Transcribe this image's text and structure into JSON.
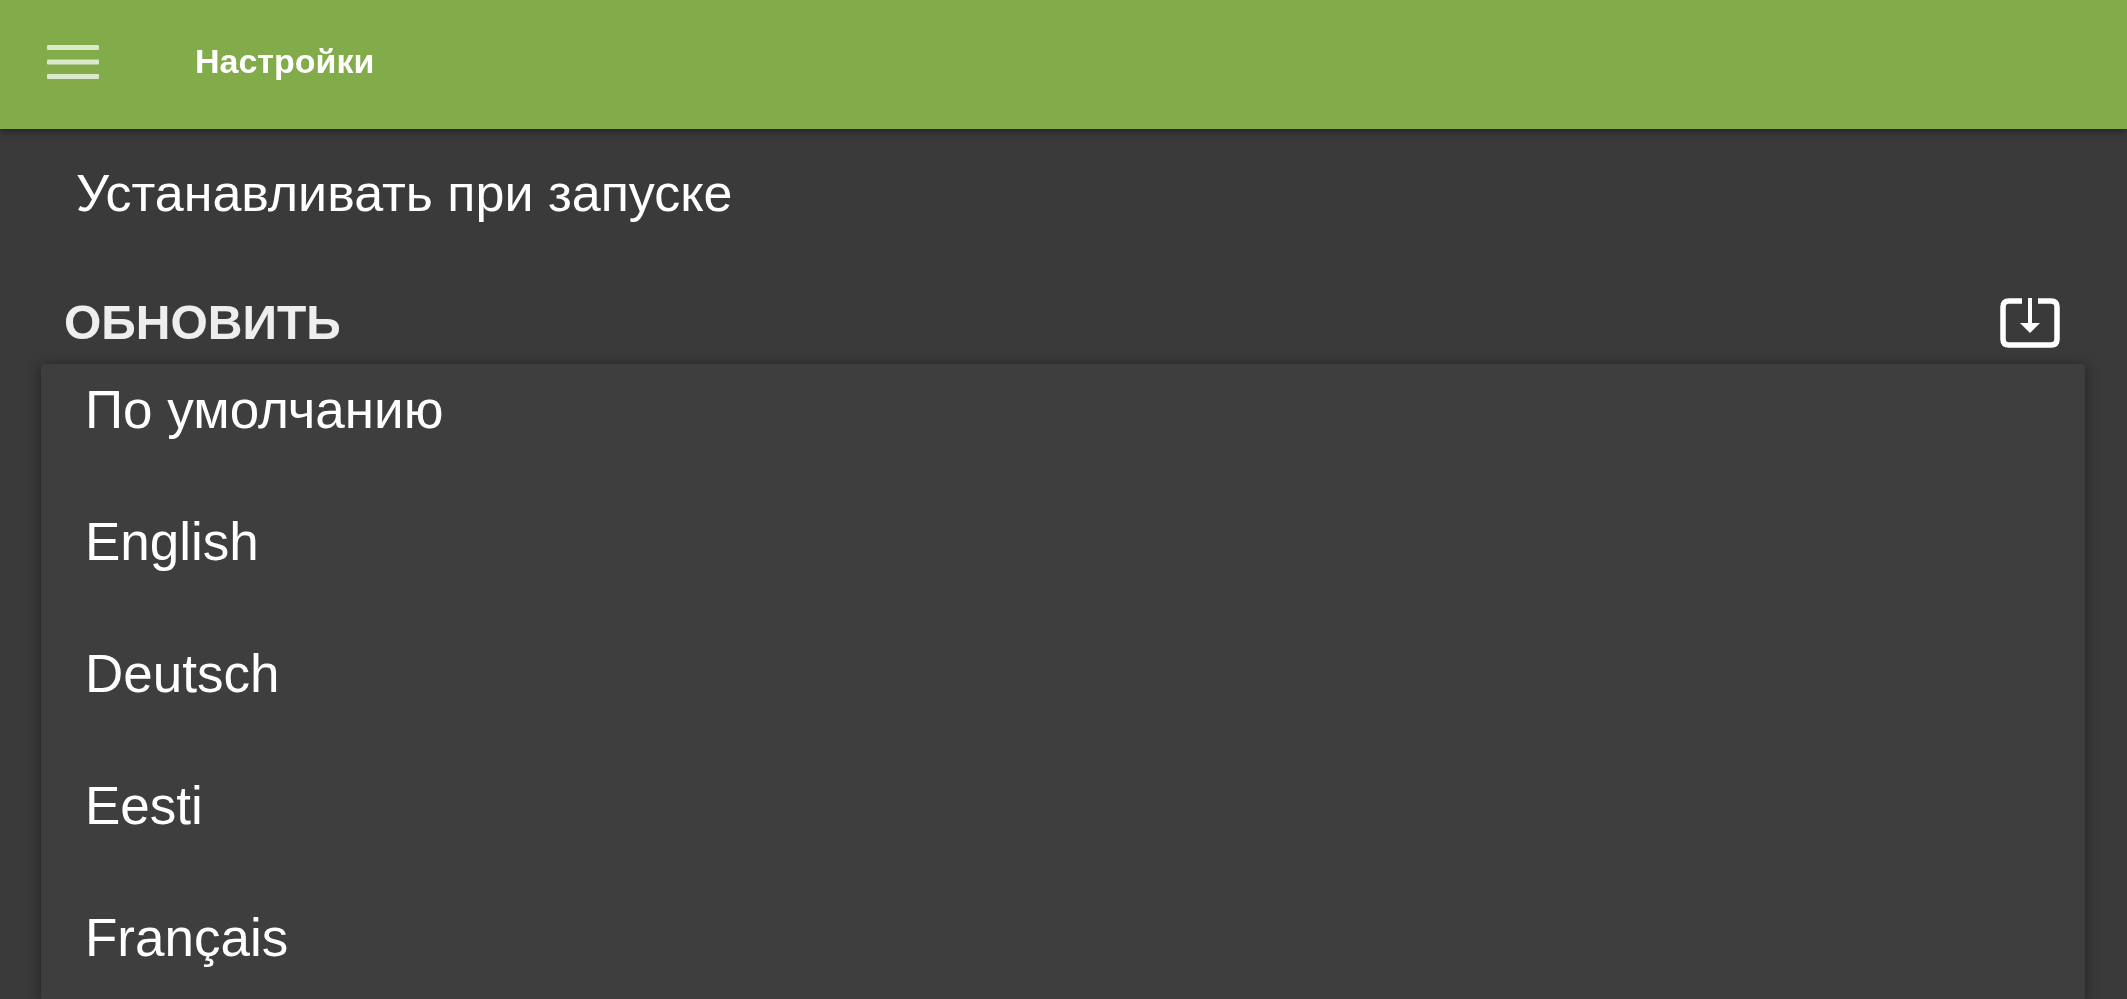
{
  "app_bar": {
    "title": "Настройки"
  },
  "settings": {
    "launch_option": "Устанавливать при запуске",
    "update_header": "ОБНОВИТЬ"
  },
  "language_menu": {
    "items": [
      {
        "label": "По умолчанию"
      },
      {
        "label": "English"
      },
      {
        "label": "Deutsch"
      },
      {
        "label": "Eesti"
      },
      {
        "label": "Français"
      }
    ]
  }
}
